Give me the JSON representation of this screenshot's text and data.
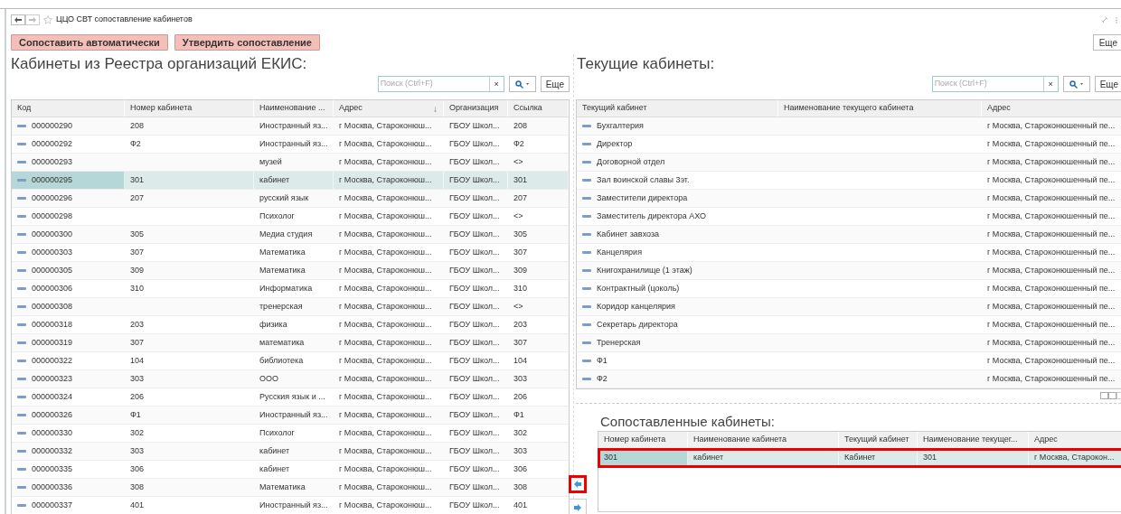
{
  "window": {
    "title": "ЦЦО СВТ сопоставление кабинетов"
  },
  "toolbar": {
    "buttons": [
      "Сопоставить автоматически",
      "Утвердить сопоставление"
    ],
    "more": "Еще"
  },
  "left": {
    "title": "Кабинеты из Реестра организаций ЕКИС:",
    "search": {
      "placeholder": "Поиск (Ctrl+F)",
      "clear": "×"
    },
    "more": "Еще",
    "columns": [
      "Код",
      "Номер кабинета",
      "Наименование ...",
      "Адрес",
      "Организация",
      "Ссылка"
    ],
    "sort_mark": "↓",
    "rows": [
      {
        "cells": [
          "000000290",
          "208",
          "Иностранный яз...",
          "г Москва, Староконюш...",
          "ГБОУ Школ...",
          "208"
        ],
        "selected": false
      },
      {
        "cells": [
          "000000292",
          "Ф2",
          "Иностранный яз...",
          "г Москва, Староконюш...",
          "ГБОУ Школ...",
          "Ф2"
        ],
        "selected": false
      },
      {
        "cells": [
          "000000293",
          "",
          "музей",
          "г Москва, Староконюш...",
          "ГБОУ Школ...",
          "<>"
        ],
        "selected": false
      },
      {
        "cells": [
          "000000295",
          "301",
          "кабинет",
          "г Москва, Староконюш...",
          "ГБОУ Школ...",
          "301"
        ],
        "selected": true
      },
      {
        "cells": [
          "000000296",
          "207",
          "русский язык",
          "г Москва, Староконюш...",
          "ГБОУ Школ...",
          "207"
        ],
        "selected": false
      },
      {
        "cells": [
          "000000298",
          "",
          "Психолог",
          "г Москва, Староконюш...",
          "ГБОУ Школ...",
          "<>"
        ],
        "selected": false
      },
      {
        "cells": [
          "000000300",
          "305",
          "Медиа студия",
          "г Москва, Староконюш...",
          "ГБОУ Школ...",
          "305"
        ],
        "selected": false
      },
      {
        "cells": [
          "000000303",
          "307",
          "Математика",
          "г Москва, Староконюш...",
          "ГБОУ Школ...",
          "307"
        ],
        "selected": false
      },
      {
        "cells": [
          "000000305",
          "309",
          "Математика",
          "г Москва, Староконюш...",
          "ГБОУ Школ...",
          "309"
        ],
        "selected": false
      },
      {
        "cells": [
          "000000306",
          "310",
          "Информатика",
          "г Москва, Староконюш...",
          "ГБОУ Школ...",
          "310"
        ],
        "selected": false
      },
      {
        "cells": [
          "000000308",
          "",
          "тренерская",
          "г Москва, Староконюш...",
          "ГБОУ Школ...",
          "<>"
        ],
        "selected": false
      },
      {
        "cells": [
          "000000318",
          "203",
          "физика",
          "г Москва, Староконюш...",
          "ГБОУ Школ...",
          "203"
        ],
        "selected": false
      },
      {
        "cells": [
          "000000319",
          "307",
          "математика",
          "г Москва, Староконюш...",
          "ГБОУ Школ...",
          "307"
        ],
        "selected": false
      },
      {
        "cells": [
          "000000322",
          "104",
          "библиотека",
          "г Москва, Староконюш...",
          "ГБОУ Школ...",
          "104"
        ],
        "selected": false
      },
      {
        "cells": [
          "000000323",
          "303",
          "ООО",
          "г Москва, Староконюш...",
          "ГБОУ Школ...",
          "303"
        ],
        "selected": false
      },
      {
        "cells": [
          "000000324",
          "206",
          "Русския язык и ...",
          "г Москва, Староконюш...",
          "ГБОУ Школ...",
          "206"
        ],
        "selected": false
      },
      {
        "cells": [
          "000000326",
          "Ф1",
          "Иностранный яз...",
          "г Москва, Староконюш...",
          "ГБОУ Школ...",
          "Ф1"
        ],
        "selected": false
      },
      {
        "cells": [
          "000000330",
          "302",
          "Психолог",
          "г Москва, Староконюш...",
          "ГБОУ Школ...",
          "302"
        ],
        "selected": false
      },
      {
        "cells": [
          "000000332",
          "303",
          "кабинет",
          "г Москва, Староконюш...",
          "ГБОУ Школ...",
          "303"
        ],
        "selected": false
      },
      {
        "cells": [
          "000000335",
          "306",
          "кабинет",
          "г Москва, Староконюш...",
          "ГБОУ Школ...",
          "306"
        ],
        "selected": false
      },
      {
        "cells": [
          "000000336",
          "308",
          "Математика",
          "г Москва, Староконюш...",
          "ГБОУ Школ...",
          "308"
        ],
        "selected": false
      },
      {
        "cells": [
          "000000337",
          "401",
          "Иностранный яз...",
          "г Москва, Староконюш...",
          "ГБОУ Школ...",
          "401"
        ],
        "selected": false
      }
    ]
  },
  "right": {
    "title": "Текущие кабинеты:",
    "search": {
      "placeholder": "Поиск (Ctrl+F)",
      "clear": "×"
    },
    "more": "Еще",
    "columns": [
      "Текущий кабинет",
      "Наименование текущего кабинета",
      "Адрес"
    ],
    "rows": [
      {
        "cells": [
          "Бухгалтерия",
          "",
          "г Москва, Староконюшенный пе..."
        ]
      },
      {
        "cells": [
          "Директор",
          "",
          "г Москва, Староконюшенный пе..."
        ]
      },
      {
        "cells": [
          "Договорной отдел",
          "",
          "г Москва, Староконюшенный пе..."
        ]
      },
      {
        "cells": [
          "Зал воинской славы 3эт.",
          "",
          "г Москва, Староконюшенный пе..."
        ]
      },
      {
        "cells": [
          "Заместители директора",
          "",
          "г Москва, Староконюшенный пе..."
        ]
      },
      {
        "cells": [
          "Заместитель директора АХО",
          "",
          "г Москва, Староконюшенный пе..."
        ]
      },
      {
        "cells": [
          "Кабинет завхоза",
          "",
          "г Москва, Староконюшенный пе..."
        ]
      },
      {
        "cells": [
          "Канцелярия",
          "",
          "г Москва, Староконюшенный пе..."
        ]
      },
      {
        "cells": [
          "Книгохранилище (1 этаж)",
          "",
          "г Москва, Староконюшенный пе..."
        ]
      },
      {
        "cells": [
          "Контрактный (цоколь)",
          "",
          "г Москва, Староконюшенный пе..."
        ]
      },
      {
        "cells": [
          "Коридор канцелярия",
          "",
          "г Москва, Староконюшенный пе..."
        ]
      },
      {
        "cells": [
          "Секретарь директора",
          "",
          "г Москва, Староконюшенный пе..."
        ]
      },
      {
        "cells": [
          "Тренерская",
          "",
          "г Москва, Староконюшенный пе..."
        ]
      },
      {
        "cells": [
          "Ф1",
          "",
          "г Москва, Староконюшенный пе..."
        ]
      },
      {
        "cells": [
          "Ф2",
          "",
          "г Москва, Староконюшенный пе..."
        ]
      }
    ]
  },
  "matched": {
    "title": "Сопоставленные кабинеты:",
    "columns": [
      "Номер кабинета",
      "Наименование кабинета",
      "Текущий кабинет",
      "Наименование текущег...",
      "Адрес"
    ],
    "rows": [
      {
        "cells": [
          "301",
          "кабинет",
          "Кабинет",
          "301",
          "г Москва, Старокон..."
        ],
        "selected": true,
        "outlined": true
      }
    ],
    "arrow_buttons": [
      {
        "kind": "left",
        "outlined": true
      },
      {
        "kind": "right",
        "outlined": false
      }
    ]
  }
}
